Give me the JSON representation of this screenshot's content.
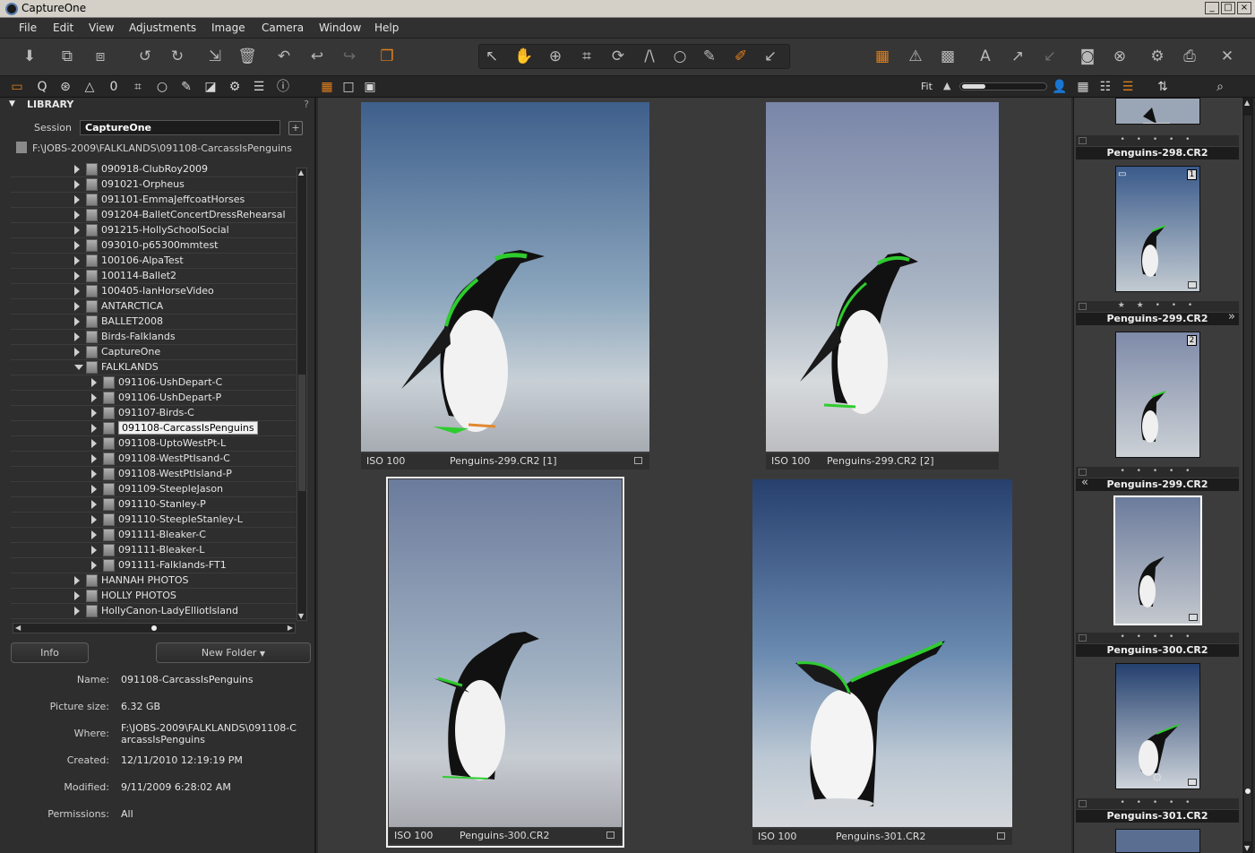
{
  "window": {
    "title": "CaptureOne",
    "controls": [
      "_",
      "□",
      "×"
    ]
  },
  "menu": [
    "File",
    "Edit",
    "View",
    "Adjustments",
    "Image",
    "Camera",
    "Window",
    "Help"
  ],
  "toolbar": {
    "icons": [
      "import-icon",
      "compare-icon",
      "compare-alt-icon",
      "rotate-left-icon",
      "rotate-right-icon",
      "move-to-folder-icon",
      "trash-icon",
      "undo-icon",
      "back-icon",
      "forward-icon",
      "variants-icon",
      "select-icon",
      "pan-icon",
      "zoom-icon",
      "crop-icon",
      "rotate-icon",
      "keystone-icon",
      "spot-icon",
      "brush-icon",
      "eraser-icon",
      "pick-icon",
      "overlay-icon",
      "warning-icon",
      "grid-icon",
      "text-icon",
      "copy-icon",
      "apply-icon",
      "camera-icon",
      "cancel-icon",
      "settings-icon",
      "print-icon",
      "tools-icon"
    ]
  },
  "subtoolbar": {
    "left_icons": [
      "library-tab-icon",
      "capture-tab-icon",
      "color-tab-icon",
      "exposure-tab-icon",
      "lens-tab-icon",
      "composition-tab-icon",
      "details-tab-icon",
      "adjustments-tab-icon",
      "metadata-tab-icon",
      "output-tab-icon",
      "batch-tab-icon",
      "quick-tab-icon"
    ],
    "view_icons": [
      "multi-view-icon",
      "grid-view-icon",
      "single-view-icon",
      "fullscreen-icon"
    ],
    "fit_label": "Fit",
    "right_icons": [
      "person-icon",
      "thumbnails-icon",
      "list-icon",
      "filmstrip-icon",
      "sort-icon",
      "search-icon"
    ]
  },
  "library": {
    "header": "LIBRARY",
    "help": "?",
    "session_label": "Session",
    "session_value": "CaptureOne",
    "add_label": "+",
    "path": "F:\\JOBS-2009\\FALKLANDS\\091108-CarcassIsPenguins",
    "folders": [
      {
        "name": "090918-ClubRoy2009",
        "level": 0,
        "open": false,
        "selected": false
      },
      {
        "name": "091021-Orpheus",
        "level": 0,
        "open": false,
        "selected": false
      },
      {
        "name": "091101-EmmaJeffcoatHorses",
        "level": 0,
        "open": false,
        "selected": false
      },
      {
        "name": "091204-BalletConcertDressRehearsal",
        "level": 0,
        "open": false,
        "selected": false
      },
      {
        "name": "091215-HollySchoolSocial",
        "level": 0,
        "open": false,
        "selected": false
      },
      {
        "name": "093010-p65300mmtest",
        "level": 0,
        "open": false,
        "selected": false
      },
      {
        "name": "100106-AlpaTest",
        "level": 0,
        "open": false,
        "selected": false
      },
      {
        "name": "100114-Ballet2",
        "level": 0,
        "open": false,
        "selected": false
      },
      {
        "name": "100405-IanHorseVideo",
        "level": 0,
        "open": false,
        "selected": false
      },
      {
        "name": "ANTARCTICA",
        "level": 0,
        "open": false,
        "selected": false
      },
      {
        "name": "BALLET2008",
        "level": 0,
        "open": false,
        "selected": false
      },
      {
        "name": "Birds-Falklands",
        "level": 0,
        "open": false,
        "selected": false
      },
      {
        "name": "CaptureOne",
        "level": 0,
        "open": false,
        "selected": false
      },
      {
        "name": "FALKLANDS",
        "level": 0,
        "open": true,
        "selected": false
      },
      {
        "name": "091106-UshDepart-C",
        "level": 1,
        "open": false,
        "selected": false
      },
      {
        "name": "091106-UshDepart-P",
        "level": 1,
        "open": false,
        "selected": false
      },
      {
        "name": "091107-Birds-C",
        "level": 1,
        "open": false,
        "selected": false
      },
      {
        "name": "091108-CarcassIsPenguins",
        "level": 1,
        "open": false,
        "selected": true
      },
      {
        "name": "091108-UptoWestPt-L",
        "level": 1,
        "open": false,
        "selected": false
      },
      {
        "name": "091108-WestPtIsand-C",
        "level": 1,
        "open": false,
        "selected": false
      },
      {
        "name": "091108-WestPtIsland-P",
        "level": 1,
        "open": false,
        "selected": false
      },
      {
        "name": "091109-SteepleJason",
        "level": 1,
        "open": false,
        "selected": false
      },
      {
        "name": "091110-Stanley-P",
        "level": 1,
        "open": false,
        "selected": false
      },
      {
        "name": "091110-SteepleStanley-L",
        "level": 1,
        "open": false,
        "selected": false
      },
      {
        "name": "091111-Bleaker-C",
        "level": 1,
        "open": false,
        "selected": false
      },
      {
        "name": "091111-Bleaker-L",
        "level": 1,
        "open": false,
        "selected": false
      },
      {
        "name": "091111-Falklands-FT1",
        "level": 1,
        "open": false,
        "selected": false
      },
      {
        "name": "HANNAH PHOTOS",
        "level": 0,
        "open": false,
        "selected": false
      },
      {
        "name": "HOLLY PHOTOS",
        "level": 0,
        "open": false,
        "selected": false
      },
      {
        "name": "HollyCanon-LadyElliotIsland",
        "level": 0,
        "open": false,
        "selected": false
      }
    ],
    "info_button": "Info",
    "new_folder_button": "New Folder",
    "info": {
      "name_label": "Name:",
      "name": "091108-CarcassIsPenguins",
      "size_label": "Picture size:",
      "size": "6.32 GB",
      "where_label": "Where:",
      "where_1": "F:\\JOBS-2009\\FALKLANDS\\091108-C",
      "where_2": "arcassIsPenguins",
      "created_label": "Created:",
      "created": "12/11/2010 12:19:19 PM",
      "modified_label": "Modified:",
      "modified": "9/11/2009 6:28:02 AM",
      "permissions_label": "Permissions:",
      "permissions": "All"
    }
  },
  "viewer": {
    "cells": [
      {
        "iso": "ISO 100",
        "file": "Penguins-299.CR2 [1]",
        "selected": false
      },
      {
        "iso": "ISO 100",
        "file": "Penguins-299.CR2 [2]",
        "selected": false
      },
      {
        "iso": "ISO 100",
        "file": "Penguins-300.CR2",
        "selected": true
      },
      {
        "iso": "ISO 100",
        "file": "Penguins-301.CR2",
        "selected": false
      }
    ]
  },
  "browser": {
    "items": [
      {
        "name": "Penguins-298.CR2",
        "rating": "• • • • •"
      },
      {
        "name": "Penguins-299.CR2",
        "rating": "★ ★ • • •",
        "badge": "1",
        "arrow_right": "»"
      },
      {
        "name": "Penguins-299.CR2",
        "rating": "• • • • •",
        "badge": "2",
        "arrow_left": "«"
      },
      {
        "name": "Penguins-300.CR2",
        "rating": "• • • • •"
      },
      {
        "name": "Penguins-301.CR2",
        "rating": "• • • • •"
      }
    ]
  },
  "colors": {
    "accent": "#e2801c",
    "background": "#2b2b2b",
    "panel": "#2e2e2e",
    "viewer": "#3a3a3a",
    "clip_highlight": "#2ecc2e"
  }
}
